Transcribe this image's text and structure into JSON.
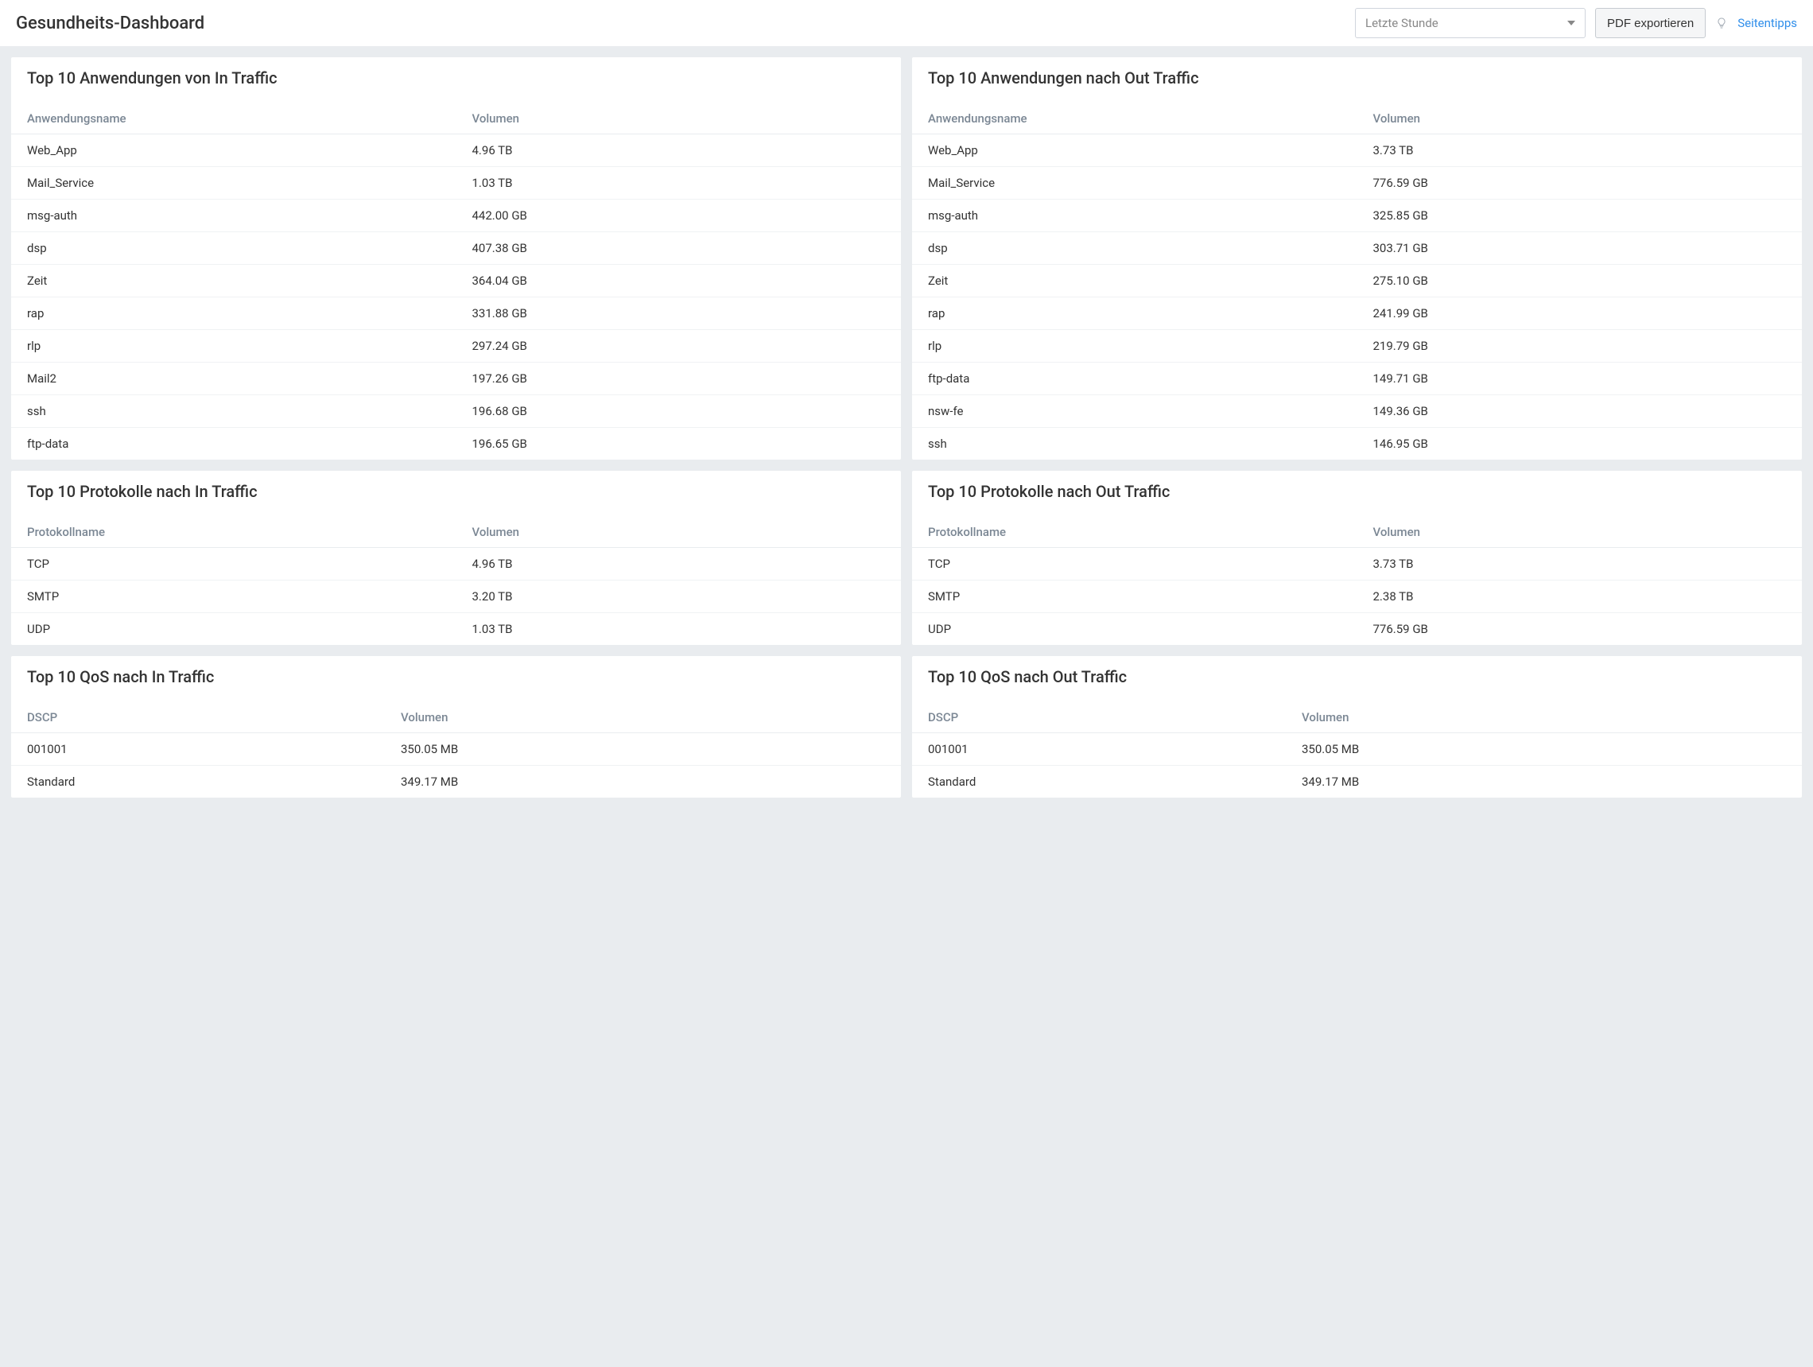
{
  "header": {
    "title": "Gesundheits-Dashboard",
    "time_range": "Letzte Stunde",
    "export_label": "PDF exportieren",
    "tips_label": "Seitentipps"
  },
  "panels": {
    "apps_in": {
      "title": "Top 10 Anwendungen von In Traffic",
      "col_name": "Anwendungsname",
      "col_vol": "Volumen",
      "rows": [
        {
          "name": "Web_App",
          "vol": "4.96 TB"
        },
        {
          "name": "Mail_Service",
          "vol": "1.03 TB"
        },
        {
          "name": "msg-auth",
          "vol": "442.00 GB"
        },
        {
          "name": "dsp",
          "vol": "407.38 GB"
        },
        {
          "name": "Zeit",
          "vol": "364.04 GB"
        },
        {
          "name": "rap",
          "vol": "331.88 GB"
        },
        {
          "name": "rlp",
          "vol": "297.24 GB"
        },
        {
          "name": "Mail2",
          "vol": "197.26 GB"
        },
        {
          "name": "ssh",
          "vol": "196.68 GB"
        },
        {
          "name": "ftp-data",
          "vol": "196.65 GB"
        }
      ]
    },
    "apps_out": {
      "title": "Top 10 Anwendungen nach Out Traffic",
      "col_name": "Anwendungsname",
      "col_vol": "Volumen",
      "rows": [
        {
          "name": "Web_App",
          "vol": "3.73 TB"
        },
        {
          "name": "Mail_Service",
          "vol": "776.59 GB"
        },
        {
          "name": "msg-auth",
          "vol": "325.85 GB"
        },
        {
          "name": "dsp",
          "vol": "303.71 GB"
        },
        {
          "name": "Zeit",
          "vol": "275.10 GB"
        },
        {
          "name": "rap",
          "vol": "241.99 GB"
        },
        {
          "name": "rlp",
          "vol": "219.79 GB"
        },
        {
          "name": "ftp-data",
          "vol": "149.71 GB"
        },
        {
          "name": "nsw-fe",
          "vol": "149.36 GB"
        },
        {
          "name": "ssh",
          "vol": "146.95 GB"
        }
      ]
    },
    "proto_in": {
      "title": "Top 10 Protokolle nach In Traffic",
      "col_name": "Protokollname",
      "col_vol": "Volumen",
      "rows": [
        {
          "name": "TCP",
          "vol": "4.96 TB"
        },
        {
          "name": "SMTP",
          "vol": "3.20 TB"
        },
        {
          "name": "UDP",
          "vol": "1.03 TB"
        }
      ]
    },
    "proto_out": {
      "title": "Top 10 Protokolle nach Out Traffic",
      "col_name": "Protokollname",
      "col_vol": "Volumen",
      "rows": [
        {
          "name": "TCP",
          "vol": "3.73 TB"
        },
        {
          "name": "SMTP",
          "vol": "2.38 TB"
        },
        {
          "name": "UDP",
          "vol": "776.59 GB"
        }
      ]
    },
    "qos_in": {
      "title": "Top 10 QoS nach In Traffic",
      "col_name": "DSCP",
      "col_vol": "Volumen",
      "rows": [
        {
          "name": "001001",
          "vol": "350.05 MB"
        },
        {
          "name": "Standard",
          "vol": "349.17 MB"
        }
      ]
    },
    "qos_out": {
      "title": "Top 10 QoS nach Out Traffic",
      "col_name": "DSCP",
      "col_vol": "Volumen",
      "rows": [
        {
          "name": "001001",
          "vol": "350.05 MB"
        },
        {
          "name": "Standard",
          "vol": "349.17 MB"
        }
      ]
    }
  }
}
